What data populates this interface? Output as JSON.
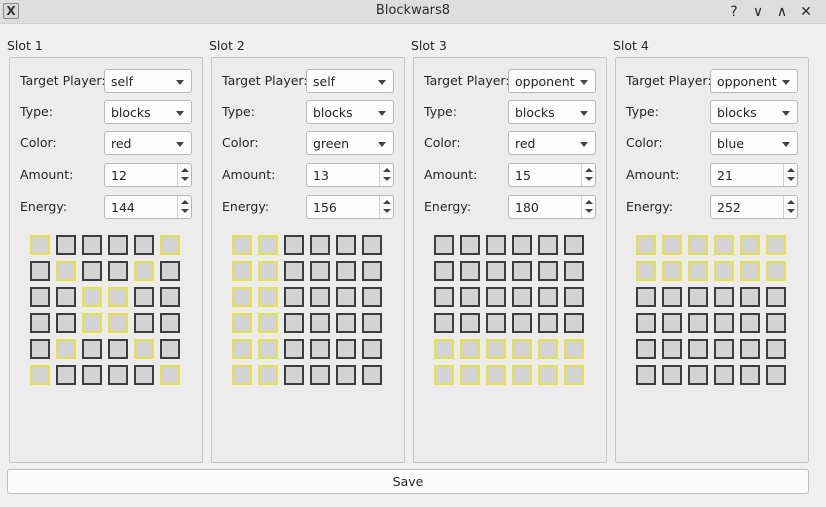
{
  "window": {
    "title": "Blockwars8",
    "help_glyph": "?",
    "minimize_glyph": "∨",
    "maximize_glyph": "∧",
    "close_glyph": "✕",
    "icon_glyph": "X"
  },
  "labels": {
    "target_player": "Target Player:",
    "type": "Type:",
    "color": "Color:",
    "amount": "Amount:",
    "energy": "Energy:"
  },
  "slots": [
    {
      "name": "Slot 1",
      "target_player": "self",
      "type": "blocks",
      "color": "red",
      "amount": "12",
      "energy": "144",
      "pattern": [
        [
          1,
          0,
          0,
          0,
          0,
          1
        ],
        [
          0,
          1,
          0,
          0,
          1,
          0
        ],
        [
          0,
          0,
          1,
          1,
          0,
          0
        ],
        [
          0,
          0,
          1,
          1,
          0,
          0
        ],
        [
          0,
          1,
          0,
          0,
          1,
          0
        ],
        [
          1,
          0,
          0,
          0,
          0,
          1
        ]
      ]
    },
    {
      "name": "Slot 2",
      "target_player": "self",
      "type": "blocks",
      "color": "green",
      "amount": "13",
      "energy": "156",
      "pattern": [
        [
          1,
          1,
          0,
          0,
          0,
          0
        ],
        [
          1,
          1,
          0,
          0,
          0,
          0
        ],
        [
          1,
          1,
          0,
          0,
          0,
          0
        ],
        [
          1,
          1,
          0,
          0,
          0,
          0
        ],
        [
          1,
          1,
          0,
          0,
          0,
          0
        ],
        [
          1,
          1,
          0,
          0,
          0,
          0
        ]
      ]
    },
    {
      "name": "Slot 3",
      "target_player": "opponent",
      "type": "blocks",
      "color": "red",
      "amount": "15",
      "energy": "180",
      "pattern": [
        [
          0,
          0,
          0,
          0,
          0,
          0
        ],
        [
          0,
          0,
          0,
          0,
          0,
          0
        ],
        [
          0,
          0,
          0,
          0,
          0,
          0
        ],
        [
          0,
          0,
          0,
          0,
          0,
          0
        ],
        [
          1,
          1,
          1,
          1,
          1,
          1
        ],
        [
          1,
          1,
          1,
          1,
          1,
          1
        ]
      ]
    },
    {
      "name": "Slot 4",
      "target_player": "opponent",
      "type": "blocks",
      "color": "blue",
      "amount": "21",
      "energy": "252",
      "pattern": [
        [
          1,
          1,
          1,
          1,
          1,
          1
        ],
        [
          1,
          1,
          1,
          1,
          1,
          1
        ],
        [
          0,
          0,
          0,
          0,
          0,
          0
        ],
        [
          0,
          0,
          0,
          0,
          0,
          0
        ],
        [
          0,
          0,
          0,
          0,
          0,
          0
        ],
        [
          0,
          0,
          0,
          0,
          0,
          0
        ]
      ]
    }
  ],
  "save_label": "Save",
  "colors": {
    "selected_cell_border": "#e6e04a",
    "cell_border": "#3d3d3d",
    "cell_fill": "#d3d3d3"
  }
}
